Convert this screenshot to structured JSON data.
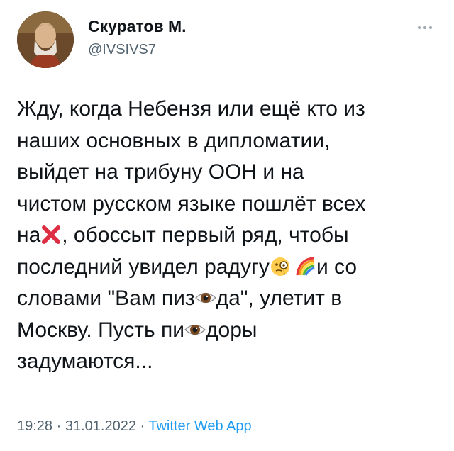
{
  "author": {
    "display_name": "Скуратов М.",
    "handle": "@IVSIVS7",
    "avatar_icon": "portrait-avatar"
  },
  "more_icon": "ellipsis-icon",
  "tweet": {
    "line1": "Жду, когда Небензя или ещё кто из",
    "line2": "наших основных в дипломатии,",
    "line3": "выйдет на трибуну ООН и на",
    "line4": "чистом русском языке пошлёт всех",
    "line5_a": "на",
    "line5_b": ", обоссыт первый ряд, чтобы",
    "line6_a": "последний увидел радугу",
    "line6_b": "и со",
    "line7_a": "словами \"Вам пиз",
    "line7_b": "да\", улетит в",
    "line8_a": "Москву. Пусть пи",
    "line8_b": "доры",
    "line9": "задумаются..."
  },
  "emojis": [
    "cross-mark-icon",
    "monocle-face-icon",
    "rainbow-icon",
    "eye-icon",
    "eye-icon"
  ],
  "meta": {
    "time": "19:28",
    "sep1": " · ",
    "date": "31.01.2022",
    "sep2": " · ",
    "source": "Twitter Web App"
  },
  "colors": {
    "text": "#0f1419",
    "secondary": "#536471",
    "link": "#1d9bf0"
  }
}
